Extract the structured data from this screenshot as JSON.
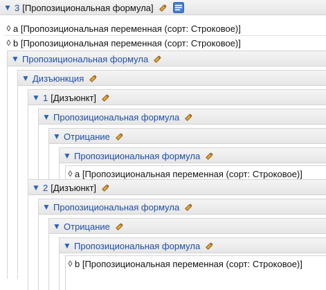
{
  "root": {
    "number": "3",
    "label": "[Пропозициональная формула]"
  },
  "var_a_top": "a [Пропозициональная переменная (сорт: Строковое)]",
  "var_b_top": "b [Пропозициональная переменная (сорт: Строковое)]",
  "formula_label": "Пропозициональная формула",
  "disjunction_label": "Дизъюнкция",
  "disjunct1": {
    "number": "1",
    "label": "[Дизъюнкт]"
  },
  "disjunct2": {
    "number": "2",
    "label": "[Дизъюнкт]"
  },
  "negation_label": "Отрицание",
  "var_a_inner": "a [Пропозициональная переменная (сорт: Строковое)]",
  "var_b_inner": "b [Пропозициональная переменная (сорт: Строковое)]",
  "icons": {
    "toggle": "triangle-down-icon",
    "leaf": "diamond-icon",
    "edit": "edit-hand-icon",
    "form": "form-view-icon"
  },
  "colors": {
    "link_blue": "#1f4fa8",
    "toggle_blue": "#2a62b8",
    "header_bg": "#eaeaea"
  }
}
